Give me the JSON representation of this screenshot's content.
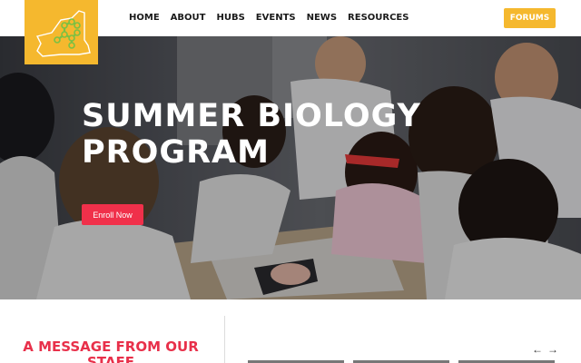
{
  "header": {
    "nav": [
      "HOME",
      "ABOUT",
      "HUBS",
      "EVENTS",
      "NEWS",
      "RESOURCES"
    ],
    "forums_label": "FORUMS"
  },
  "hero": {
    "title_line1": "SUMMER BIOLOGY",
    "title_line2": "PROGRAM",
    "enroll_label": "Enroll Now"
  },
  "section": {
    "message_title": "A MESSAGE FROM OUR STAFF",
    "prev_arrow": "←",
    "next_arrow": "→"
  },
  "colors": {
    "brand_yellow": "#f5b82e",
    "accent_red": "#f0304a",
    "logo_green": "#7ac043"
  }
}
